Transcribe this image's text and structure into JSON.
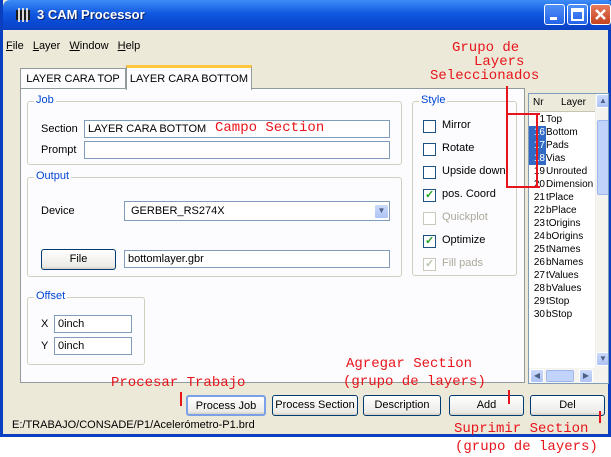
{
  "window": {
    "title": "3 CAM Processor",
    "controls": [
      "minimize-icon",
      "maximize-icon",
      "close-icon"
    ]
  },
  "menu": [
    "File",
    "Layer",
    "Window",
    "Help"
  ],
  "tabs": [
    {
      "label": "LAYER CARA TOP",
      "active": false
    },
    {
      "label": "LAYER CARA BOTTOM",
      "active": true
    }
  ],
  "job": {
    "group_label": "Job",
    "section_label": "Section",
    "section_value": "LAYER CARA BOTTOM",
    "prompt_label": "Prompt",
    "prompt_value": ""
  },
  "output": {
    "group_label": "Output",
    "device_label": "Device",
    "device_value": "GERBER_RS274X",
    "file_button": "File",
    "file_value": "bottomlayer.gbr"
  },
  "offset": {
    "group_label": "Offset",
    "x_label": "X",
    "x_value": "0inch",
    "y_label": "Y",
    "y_value": "0inch"
  },
  "style": {
    "group_label": "Style",
    "options": [
      {
        "label": "Mirror",
        "checked": false,
        "enabled": true
      },
      {
        "label": "Rotate",
        "checked": false,
        "enabled": true
      },
      {
        "label": "Upside down",
        "checked": false,
        "enabled": true
      },
      {
        "label": "pos. Coord",
        "checked": true,
        "enabled": true
      },
      {
        "label": "Quickplot",
        "checked": false,
        "enabled": false
      },
      {
        "label": "Optimize",
        "checked": true,
        "enabled": true
      },
      {
        "label": "Fill pads",
        "checked": true,
        "enabled": false
      }
    ]
  },
  "layers": {
    "header_nr": "Nr",
    "header_layer": "Layer",
    "rows": [
      {
        "nr": "1",
        "name": "Top",
        "selected": false
      },
      {
        "nr": "16",
        "name": "Bottom",
        "selected": true
      },
      {
        "nr": "17",
        "name": "Pads",
        "selected": true
      },
      {
        "nr": "18",
        "name": "Vias",
        "selected": true
      },
      {
        "nr": "19",
        "name": "Unrouted",
        "selected": false
      },
      {
        "nr": "20",
        "name": "Dimension",
        "selected": false
      },
      {
        "nr": "21",
        "name": "tPlace",
        "selected": false
      },
      {
        "nr": "22",
        "name": "bPlace",
        "selected": false
      },
      {
        "nr": "23",
        "name": "tOrigins",
        "selected": false
      },
      {
        "nr": "24",
        "name": "bOrigins",
        "selected": false
      },
      {
        "nr": "25",
        "name": "tNames",
        "selected": false
      },
      {
        "nr": "26",
        "name": "bNames",
        "selected": false
      },
      {
        "nr": "27",
        "name": "tValues",
        "selected": false
      },
      {
        "nr": "28",
        "name": "bValues",
        "selected": false
      },
      {
        "nr": "29",
        "name": "tStop",
        "selected": false
      },
      {
        "nr": "30",
        "name": "bStop",
        "selected": false
      }
    ]
  },
  "buttons": {
    "process_job": "Process Job",
    "process_section": "Process Section",
    "description": "Description",
    "add": "Add",
    "del": "Del"
  },
  "status_path": "E:/TRABAJO/CONSADE/P1/Acelerómetro-P1.brd",
  "annotations": {
    "grupo": [
      "Grupo de",
      "Layers",
      "Seleccionados"
    ],
    "campo_section": "Campo Section",
    "procesar_trabajo": "Procesar Trabajo",
    "agregar_section": [
      "Agregar Section",
      "(grupo de layers)"
    ],
    "suprimir_section": [
      "Suprimir Section",
      "(grupo de layers)"
    ]
  },
  "colors": {
    "annotation": "#e8141b",
    "title_bar": "#0a49d2",
    "selection": "#316ac5",
    "group_label": "#0046d5"
  }
}
